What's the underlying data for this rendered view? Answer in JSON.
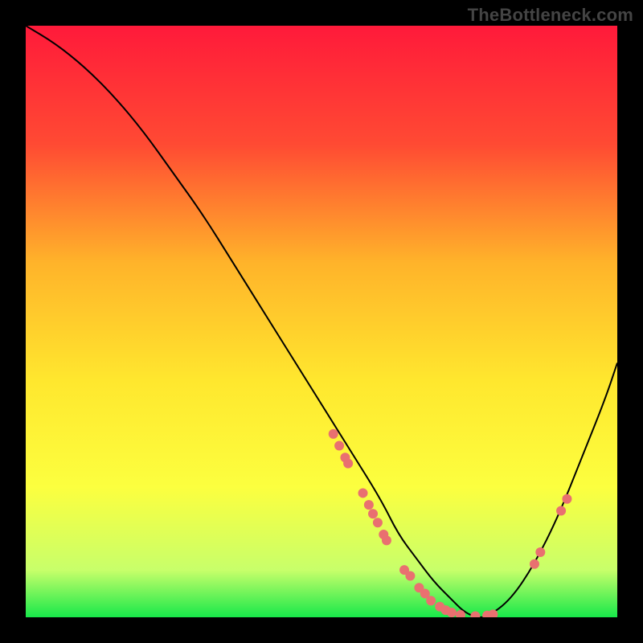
{
  "watermark": "TheBottleneck.com",
  "chart_data": {
    "type": "line",
    "title": "",
    "xlabel": "",
    "ylabel": "",
    "xlim": [
      0,
      100
    ],
    "ylim": [
      0,
      100
    ],
    "grid": false,
    "legend": false,
    "gradient_stops": [
      {
        "offset": 0,
        "color": "#ff1a3a"
      },
      {
        "offset": 20,
        "color": "#ff4a33"
      },
      {
        "offset": 40,
        "color": "#ffb32a"
      },
      {
        "offset": 60,
        "color": "#ffe72e"
      },
      {
        "offset": 78,
        "color": "#fcff3f"
      },
      {
        "offset": 92,
        "color": "#c8ff6a"
      },
      {
        "offset": 100,
        "color": "#17e84a"
      }
    ],
    "series": [
      {
        "name": "bottleneck-curve",
        "x": [
          0,
          5,
          10,
          15,
          20,
          25,
          30,
          35,
          40,
          45,
          50,
          55,
          60,
          63,
          66,
          69,
          72,
          74,
          76,
          78,
          82,
          86,
          90,
          94,
          98,
          100
        ],
        "y": [
          100,
          97,
          93,
          88,
          82,
          75,
          68,
          60,
          52,
          44,
          36,
          28,
          20,
          14,
          10,
          6,
          3,
          1,
          0,
          0,
          3,
          9,
          17,
          27,
          37,
          43
        ]
      }
    ],
    "points": [
      {
        "x": 52,
        "y": 31
      },
      {
        "x": 53,
        "y": 29
      },
      {
        "x": 54,
        "y": 27
      },
      {
        "x": 54.5,
        "y": 26
      },
      {
        "x": 57,
        "y": 21
      },
      {
        "x": 58,
        "y": 19
      },
      {
        "x": 58.7,
        "y": 17.5
      },
      {
        "x": 59.5,
        "y": 16
      },
      {
        "x": 60.5,
        "y": 14
      },
      {
        "x": 61,
        "y": 13
      },
      {
        "x": 64,
        "y": 8
      },
      {
        "x": 65,
        "y": 7
      },
      {
        "x": 66.5,
        "y": 5
      },
      {
        "x": 67.5,
        "y": 4
      },
      {
        "x": 68.5,
        "y": 2.8
      },
      {
        "x": 70,
        "y": 1.8
      },
      {
        "x": 71,
        "y": 1.2
      },
      {
        "x": 72,
        "y": 0.8
      },
      {
        "x": 73.5,
        "y": 0.4
      },
      {
        "x": 76,
        "y": 0.2
      },
      {
        "x": 78,
        "y": 0.3
      },
      {
        "x": 79,
        "y": 0.5
      },
      {
        "x": 86,
        "y": 9
      },
      {
        "x": 87,
        "y": 11
      },
      {
        "x": 90.5,
        "y": 18
      },
      {
        "x": 91.5,
        "y": 20
      }
    ],
    "point_color": "#e97070",
    "point_radius": 6,
    "line_color": "#000000",
    "line_width": 2
  }
}
